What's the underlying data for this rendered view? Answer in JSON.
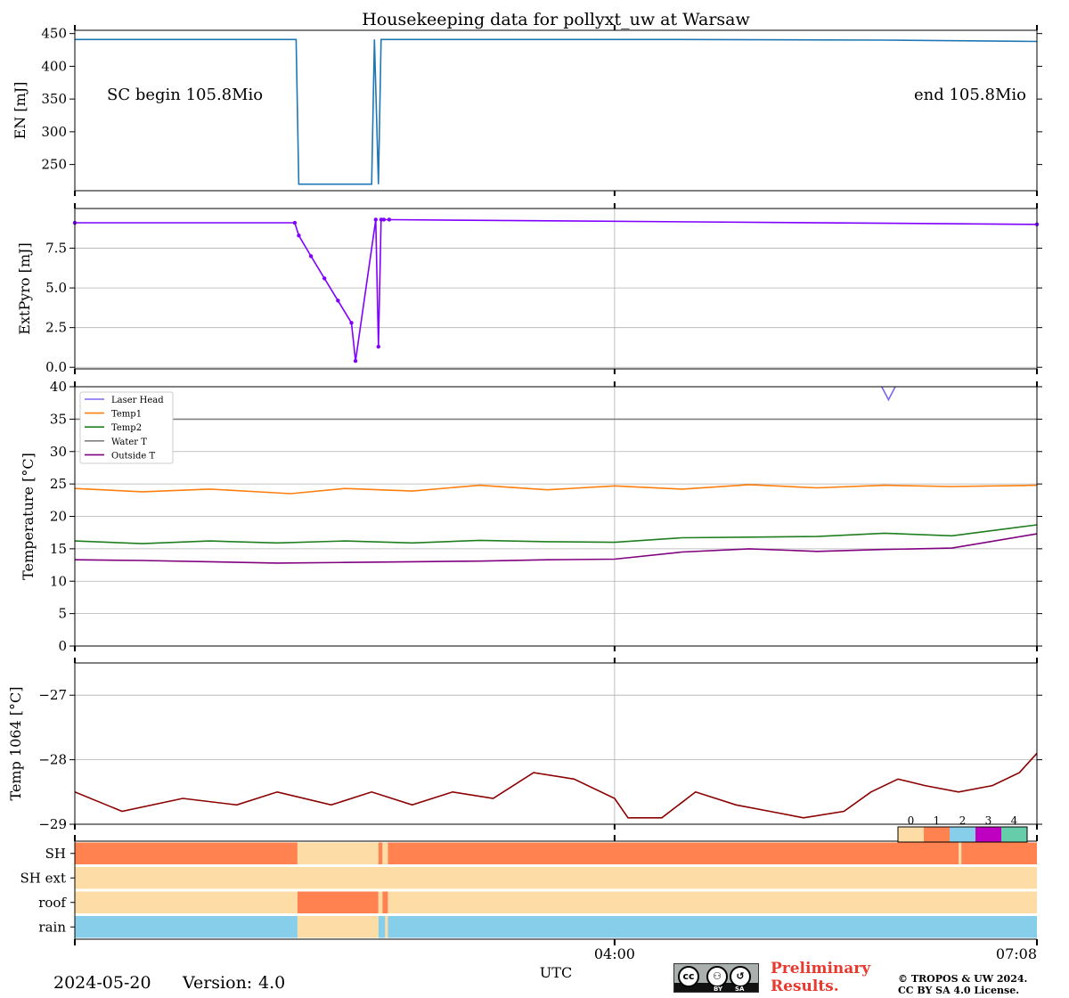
{
  "title": "Housekeeping data for pollyxt_uw at Warsaw",
  "footer": {
    "date": "2024-05-20",
    "version_label": "Version:",
    "version_value": "4.0",
    "xlabel": "UTC",
    "preliminary": "Preliminary Results.",
    "copyright_line1": "© TROPOS & UW 2024.",
    "copyright_line2": "CC BY SA 4.0 License.",
    "license_badge": "cc",
    "license_by": "BY",
    "license_sa": "SA"
  },
  "colors": {
    "en": "#1f77b4",
    "pyro": "#7f00ff",
    "laser_head": "#7b68ee",
    "temp1": "#ff7f0e",
    "temp2": "#1f7f1f",
    "water": "#808080",
    "outside": "#800080",
    "t1064": "#8b0000",
    "flag0": "#fddca5",
    "flag1": "#ff8250",
    "flag2": "#87ceeb",
    "flag3": "#c000c0",
    "flag4": "#66cdaa"
  },
  "chart_data": [
    {
      "type": "line",
      "ylabel": "EN [mJ]",
      "ylim": [
        210,
        455
      ],
      "yticks": [
        "250",
        "300",
        "350",
        "400",
        "450"
      ],
      "annotations": [
        "SC begin 105.8Mio",
        "end 105.8Mio"
      ],
      "series": [
        {
          "color": "en",
          "x": [
            0,
            1.64,
            1.66,
            2.2,
            2.22,
            2.25,
            2.27,
            2.29,
            2.31,
            4.5,
            6.0,
            7.13
          ],
          "values": [
            441,
            441,
            220,
            220,
            441,
            220,
            441,
            441,
            441,
            441,
            440,
            438
          ]
        }
      ]
    },
    {
      "type": "line",
      "ylabel": "ExtPyro [mJ]",
      "ylim": [
        -0.1,
        10.0
      ],
      "yticks": [
        "0.0",
        "2.5",
        "5.0",
        "7.5"
      ],
      "series": [
        {
          "color": "pyro",
          "marker": true,
          "x": [
            0,
            1.63,
            1.66,
            1.75,
            1.85,
            1.95,
            2.05,
            2.08,
            2.23,
            2.25,
            2.27,
            2.29,
            2.33,
            7.13
          ],
          "values": [
            9.1,
            9.1,
            8.3,
            7.0,
            5.6,
            4.2,
            2.8,
            0.4,
            9.3,
            1.3,
            9.3,
            9.3,
            9.3,
            9.0
          ]
        }
      ]
    },
    {
      "type": "line",
      "ylabel": "Temperature [$^\\circ C$]",
      "ylim": [
        0,
        40
      ],
      "yticks": [
        "0",
        "5",
        "10",
        "15",
        "20",
        "25",
        "30",
        "35",
        "40"
      ],
      "grid": true,
      "legend_position": "upper left",
      "series": [
        {
          "name": "Laser Head",
          "color": "laser_head",
          "x": [
            5.98,
            6.03,
            6.08
          ],
          "values": [
            40,
            38,
            40
          ]
        },
        {
          "name": "Temp1",
          "color": "temp1",
          "x": [
            0,
            0.5,
            1.0,
            1.6,
            2.0,
            2.5,
            3.0,
            3.5,
            4.0,
            4.5,
            5.0,
            5.5,
            6.0,
            6.5,
            7.13
          ],
          "values": [
            24.3,
            23.8,
            24.2,
            23.5,
            24.3,
            23.9,
            24.8,
            24.1,
            24.7,
            24.2,
            24.9,
            24.4,
            24.8,
            24.6,
            24.8
          ]
        },
        {
          "name": "Temp2",
          "color": "temp2",
          "x": [
            0,
            0.5,
            1.0,
            1.5,
            2.0,
            2.5,
            3.0,
            3.5,
            4.0,
            4.5,
            5.0,
            5.5,
            6.0,
            6.5,
            7.13
          ],
          "values": [
            16.2,
            15.8,
            16.2,
            15.9,
            16.2,
            15.9,
            16.3,
            16.1,
            16.0,
            16.7,
            16.8,
            16.9,
            17.4,
            17.0,
            18.7
          ]
        },
        {
          "name": "Water T",
          "color": "water",
          "x": [
            0,
            7.13
          ],
          "values": [
            35,
            35
          ]
        },
        {
          "name": "Outside T",
          "color": "outside",
          "x": [
            0,
            0.5,
            1.0,
            1.5,
            2.0,
            2.5,
            3.0,
            3.5,
            4.0,
            4.5,
            5.0,
            5.5,
            6.0,
            6.5,
            7.13
          ],
          "values": [
            13.3,
            13.2,
            13.0,
            12.8,
            12.9,
            13.0,
            13.1,
            13.3,
            13.4,
            14.5,
            15.0,
            14.6,
            14.9,
            15.1,
            17.3
          ]
        }
      ]
    },
    {
      "type": "line",
      "ylabel": "Temp 1064 [$^\\circ C$]",
      "ylim": [
        -29.0,
        -26.5
      ],
      "yticks": [
        "−27",
        "−28",
        "−29"
      ],
      "grid": true,
      "series": [
        {
          "color": "t1064",
          "x": [
            0,
            0.35,
            0.8,
            1.2,
            1.5,
            1.9,
            2.2,
            2.5,
            2.8,
            3.1,
            3.4,
            3.7,
            4.0,
            4.1,
            4.35,
            4.6,
            4.9,
            5.15,
            5.4,
            5.7,
            5.9,
            6.1,
            6.3,
            6.55,
            6.8,
            7.0,
            7.13
          ],
          "values": [
            -28.5,
            -28.8,
            -28.6,
            -28.7,
            -28.5,
            -28.7,
            -28.5,
            -28.7,
            -28.5,
            -28.6,
            -28.2,
            -28.3,
            -28.6,
            -28.9,
            -28.9,
            -28.5,
            -28.7,
            -28.8,
            -28.9,
            -28.8,
            -28.5,
            -28.3,
            -28.4,
            -28.5,
            -28.4,
            -28.2,
            -27.9
          ]
        }
      ]
    },
    {
      "type": "heatmap",
      "rows": [
        "SH",
        "SH ext",
        "roof",
        "rain"
      ],
      "colorbar_ticks": [
        "0",
        "1",
        "2",
        "3",
        "4"
      ],
      "segments": [
        [
          {
            "from": 0,
            "to": 1.65,
            "value": 1
          },
          {
            "from": 1.65,
            "to": 2.25,
            "value": 0
          },
          {
            "from": 2.25,
            "to": 2.28,
            "value": 1
          },
          {
            "from": 2.28,
            "to": 2.32,
            "value": 0
          },
          {
            "from": 2.32,
            "to": 6.55,
            "value": 1
          },
          {
            "from": 6.55,
            "to": 6.57,
            "value": 0
          },
          {
            "from": 6.57,
            "to": 7.13,
            "value": 1
          }
        ],
        [
          {
            "from": 0,
            "to": 7.13,
            "value": 0
          }
        ],
        [
          {
            "from": 0,
            "to": 1.65,
            "value": 0
          },
          {
            "from": 1.65,
            "to": 2.25,
            "value": 1
          },
          {
            "from": 2.25,
            "to": 2.28,
            "value": 0
          },
          {
            "from": 2.28,
            "to": 2.32,
            "value": 1
          },
          {
            "from": 2.32,
            "to": 7.13,
            "value": 0
          }
        ],
        [
          {
            "from": 0,
            "to": 1.65,
            "value": 2
          },
          {
            "from": 1.65,
            "to": 2.25,
            "value": 0
          },
          {
            "from": 2.25,
            "to": 2.3,
            "value": 2
          },
          {
            "from": 2.3,
            "to": 2.32,
            "value": 0
          },
          {
            "from": 2.32,
            "to": 7.13,
            "value": 2
          }
        ]
      ]
    }
  ],
  "x_axis": {
    "xlim": [
      0,
      7.13
    ],
    "ticks": [
      {
        "x": 4.0,
        "label": "04:00"
      },
      {
        "x": 7.13,
        "label": "07:08"
      }
    ]
  }
}
